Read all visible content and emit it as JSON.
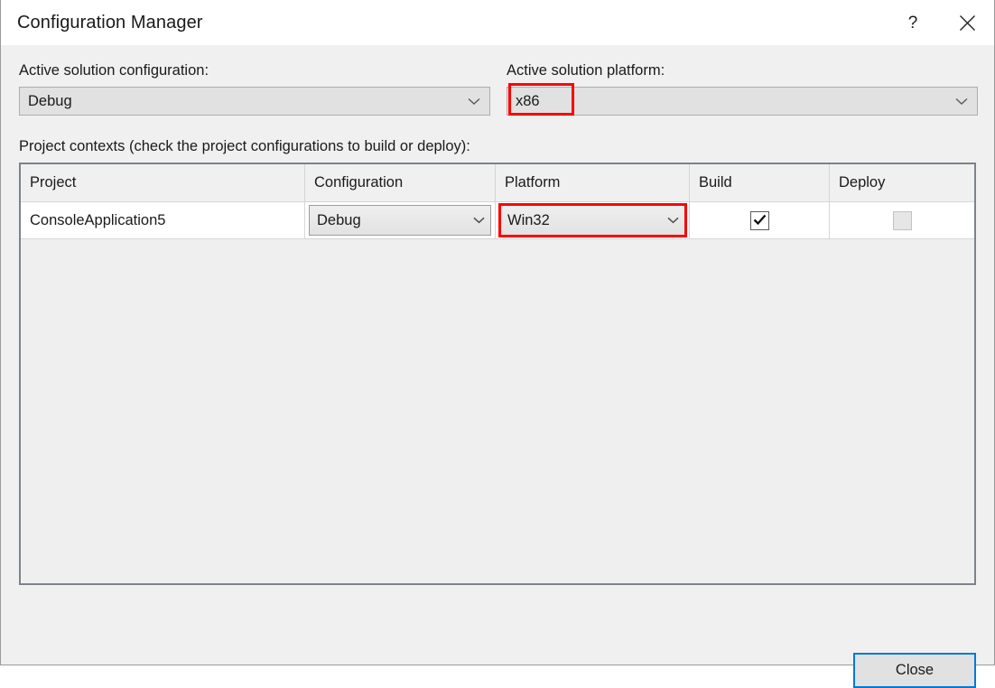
{
  "window": {
    "title": "Configuration Manager",
    "help_icon": "question-mark-icon",
    "help_glyph": "?",
    "close_icon": "close-x-icon"
  },
  "solution": {
    "configuration_label": "Active solution configuration:",
    "configuration_value": "Debug",
    "platform_label": "Active solution platform:",
    "platform_value": "x86",
    "dropdown_icon": "chevron-down-icon"
  },
  "project_contexts": {
    "label": "Project contexts (check the project configurations to build or deploy):",
    "columns": [
      "Project",
      "Configuration",
      "Platform",
      "Build",
      "Deploy"
    ],
    "rows": [
      {
        "project": "ConsoleApplication5",
        "configuration": "Debug",
        "platform": "Win32",
        "build_checked": "✔",
        "deploy_checked": "",
        "deploy_disabled": true
      }
    ]
  },
  "footer": {
    "close_label": "Close"
  },
  "annotations": {
    "platform_highlight": "x86",
    "grid_platform_highlight": "Win32",
    "color": "#ff0000"
  },
  "colors": {
    "accent": "#0078d7",
    "dialog_background": "#f0f0f0",
    "titlebar_background": "#ffffff",
    "grid_border": "#7d828c",
    "annotation_red": "#ff0000"
  }
}
